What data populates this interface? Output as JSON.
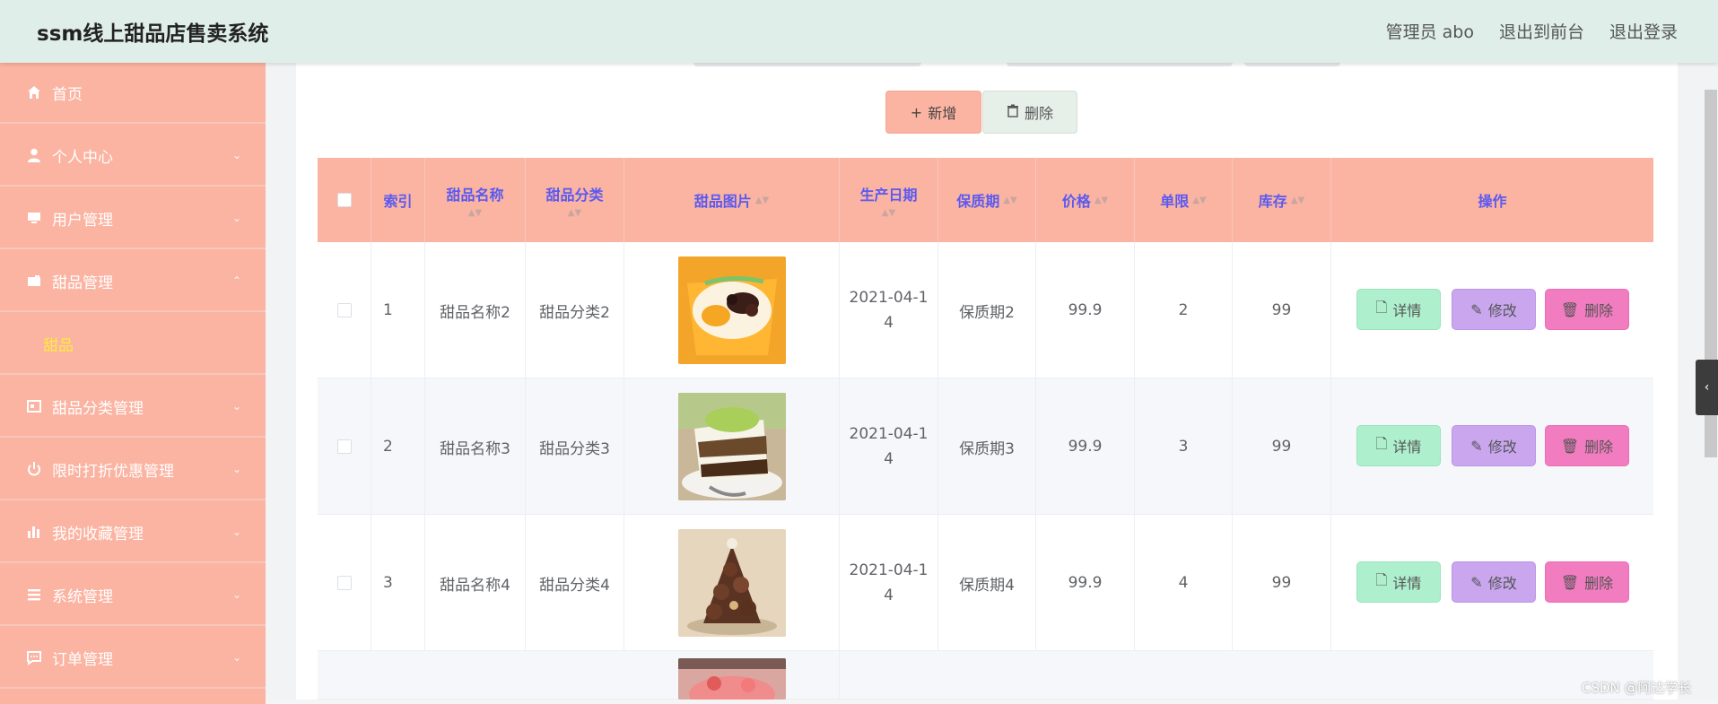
{
  "header": {
    "title": "ssm线上甜品店售卖系统",
    "admin": "管理员 abo",
    "front": "退出到前台",
    "logout": "退出登录"
  },
  "sidebar": {
    "items": [
      {
        "label": "首页",
        "icon": "home-icon"
      },
      {
        "label": "个人中心",
        "icon": "user-icon"
      },
      {
        "label": "用户管理",
        "icon": "monitor-icon"
      },
      {
        "label": "甜品管理",
        "icon": "wallet-icon"
      },
      {
        "label": "甜品",
        "icon": ""
      },
      {
        "label": "甜品分类管理",
        "icon": "card-icon"
      },
      {
        "label": "限时打折优惠管理",
        "icon": "power-icon"
      },
      {
        "label": "我的收藏管理",
        "icon": "bar-chart-icon"
      },
      {
        "label": "系统管理",
        "icon": "list-icon"
      },
      {
        "label": "订单管理",
        "icon": "chat-icon"
      }
    ]
  },
  "toolbar": {
    "add_label": "新增",
    "delete_label": "删除"
  },
  "table": {
    "headers": {
      "index": "索引",
      "name": "甜品名称",
      "category": "甜品分类",
      "image": "甜品图片",
      "date": "生产日期",
      "shelf": "保质期",
      "price": "价格",
      "limit": "单限",
      "stock": "库存",
      "ops": "操作"
    },
    "rows": [
      {
        "index": "1",
        "name": "甜品名称2",
        "category": "甜品分类2",
        "date_line1": "2021-04-1",
        "date_line2": "4",
        "shelf": "保质期2",
        "price": "99.9",
        "limit": "2",
        "stock": "99"
      },
      {
        "index": "2",
        "name": "甜品名称3",
        "category": "甜品分类3",
        "date_line1": "2021-04-1",
        "date_line2": "4",
        "shelf": "保质期3",
        "price": "99.9",
        "limit": "3",
        "stock": "99"
      },
      {
        "index": "3",
        "name": "甜品名称4",
        "category": "甜品分类4",
        "date_line1": "2021-04-1",
        "date_line2": "4",
        "shelf": "保质期4",
        "price": "99.9",
        "limit": "4",
        "stock": "99"
      }
    ],
    "actions": {
      "detail": "详情",
      "edit": "修改",
      "delete": "删除"
    }
  },
  "watermark": "CSDN @阿达学长",
  "colors": {
    "header_bg": "#dfeee8",
    "sidebar_bg": "#fbb3a2",
    "table_head_bg": "#fbb3a2",
    "header_text": "#5a5af0",
    "detail_btn": "#aef0cd",
    "edit_btn": "#c9a6ee",
    "delete_btn": "#f27cc0"
  }
}
